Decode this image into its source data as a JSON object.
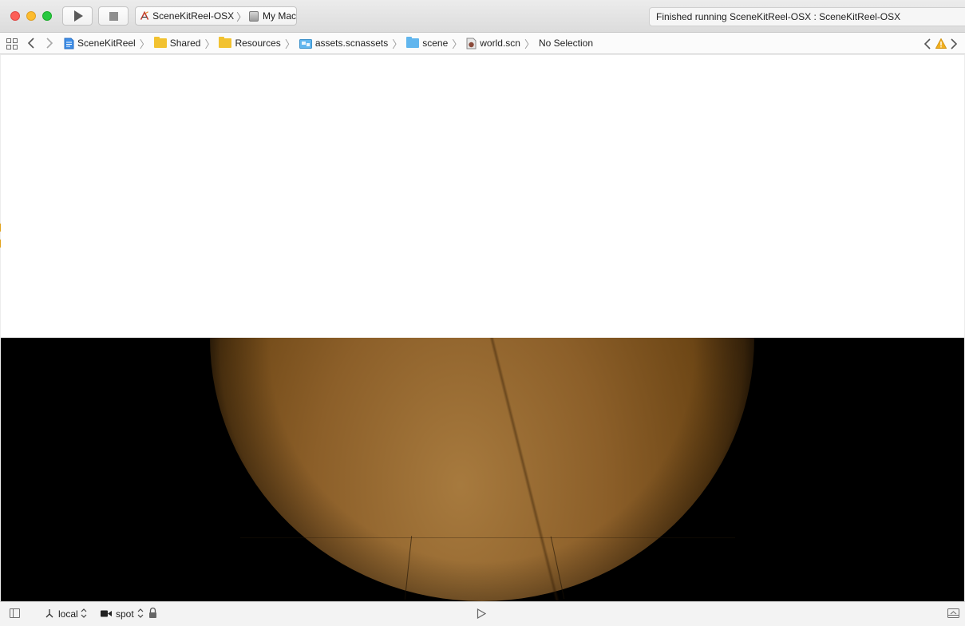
{
  "toolbar": {
    "scheme_name": "SceneKitReel-OSX",
    "destination": "My Mac",
    "activity_status": "Finished running SceneKitReel-OSX : SceneKitReel-OSX",
    "run_icon": "play-icon",
    "stop_icon": "stop-icon"
  },
  "jumpbar": {
    "crumbs": [
      {
        "label": "SceneKitReel",
        "icon": "project-icon"
      },
      {
        "label": "Shared",
        "icon": "folder-icon"
      },
      {
        "label": "Resources",
        "icon": "folder-icon"
      },
      {
        "label": "assets.scnassets",
        "icon": "asset-catalog-icon"
      },
      {
        "label": "scene",
        "icon": "folder-icon"
      },
      {
        "label": "world.scn",
        "icon": "scene-file-icon"
      },
      {
        "label": "No Selection",
        "icon": ""
      }
    ],
    "warning_color": "#f2b01e"
  },
  "bottombar": {
    "coordinate_mode": "local",
    "camera": "spot"
  },
  "colors": {
    "floor": "#8c5f29",
    "canvas_background": "#000000",
    "upper_canvas": "#ffffff"
  }
}
